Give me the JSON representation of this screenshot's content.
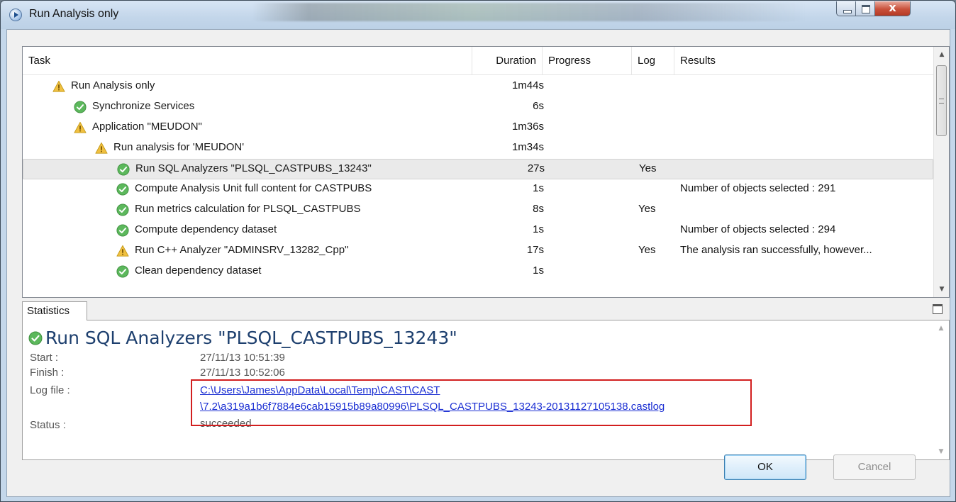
{
  "window": {
    "title": "Run Analysis only"
  },
  "table": {
    "columns": {
      "task": "Task",
      "duration": "Duration",
      "progress": "Progress",
      "log": "Log",
      "results": "Results"
    },
    "rows": [
      {
        "name": "Run Analysis only",
        "status": "warning",
        "depth": 0,
        "duration": "1m44s",
        "log": "",
        "results": ""
      },
      {
        "name": "Synchronize Services",
        "status": "success",
        "depth": 1,
        "duration": "6s",
        "log": "",
        "results": ""
      },
      {
        "name": "Application \"MEUDON\"",
        "status": "warning",
        "depth": 1,
        "duration": "1m36s",
        "log": "",
        "results": ""
      },
      {
        "name": "Run analysis for 'MEUDON'",
        "status": "warning",
        "depth": 2,
        "duration": "1m34s",
        "log": "",
        "results": ""
      },
      {
        "name": "Run SQL Analyzers \"PLSQL_CASTPUBS_13243\"",
        "status": "success",
        "depth": 3,
        "duration": "27s",
        "log": "Yes",
        "results": "",
        "selected": true
      },
      {
        "name": "Compute Analysis Unit full content for CASTPUBS",
        "status": "success",
        "depth": 3,
        "duration": "1s",
        "log": "",
        "results": "Number of objects selected : 291"
      },
      {
        "name": "Run metrics calculation for PLSQL_CASTPUBS",
        "status": "success",
        "depth": 3,
        "duration": "8s",
        "log": "Yes",
        "results": ""
      },
      {
        "name": "Compute dependency dataset",
        "status": "success",
        "depth": 3,
        "duration": "1s",
        "log": "",
        "results": "Number of objects selected : 294"
      },
      {
        "name": "Run C++ Analyzer \"ADMINSRV_13282_Cpp\"",
        "status": "warning",
        "depth": 3,
        "duration": "17s",
        "log": "Yes",
        "results": "The analysis ran successfully, however..."
      },
      {
        "name": "Clean dependency dataset",
        "status": "success",
        "depth": 3,
        "duration": "1s",
        "log": "",
        "results": ""
      }
    ]
  },
  "statistics": {
    "tab_label": "Statistics",
    "title": "Run SQL Analyzers \"PLSQL_CASTPUBS_13243\"",
    "start_label": "Start :",
    "start_value": "27/11/13 10:51:39",
    "finish_label": "Finish :",
    "finish_value": "27/11/13 10:52:06",
    "logfile_label": "Log file :",
    "logfile_line1": "C:\\Users\\James\\AppData\\Local\\Temp\\CAST\\CAST",
    "logfile_line2": "\\7.2\\a319a1b6f7884e6cab15915b89a80996\\PLSQL_CASTPUBS_13243-20131127105138.castlog",
    "status_label": "Status :",
    "status_value": "succeeded"
  },
  "buttons": {
    "ok": "OK",
    "cancel": "Cancel"
  },
  "icons": {
    "success": "check-circle-icon",
    "warning": "warning-triangle-icon"
  },
  "colors": {
    "success": "#5cb85c",
    "warning": "#f0c040",
    "highlight": "#d21f1f",
    "link": "#1b2fd3"
  }
}
